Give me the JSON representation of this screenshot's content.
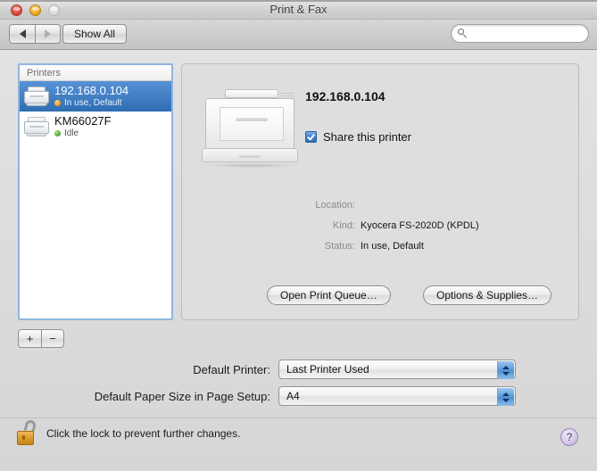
{
  "window": {
    "title": "Print & Fax",
    "traffic_lights": {
      "close": "close-button",
      "minimize": "minimize-button",
      "zoom": "zoom-button-disabled"
    }
  },
  "toolbar": {
    "back_label": "◀",
    "forward_label": "▶",
    "show_all_label": "Show All",
    "search": {
      "value": "",
      "placeholder": "",
      "icon": "search-icon"
    }
  },
  "printer_list": {
    "header": "Printers",
    "items": [
      {
        "name": "192.168.0.104",
        "status": "In use, Default",
        "status_color": "#f2a42a",
        "selected": true
      },
      {
        "name": "KM66027F",
        "status": "Idle",
        "status_color": "#4fae34",
        "selected": false
      }
    ],
    "add_label": "+",
    "remove_label": "−"
  },
  "detail": {
    "title": "192.168.0.104",
    "share_checkbox": {
      "label": "Share this printer",
      "checked": true
    },
    "info": [
      {
        "label": "Location:",
        "value": ""
      },
      {
        "label": "Kind:",
        "value": "Kyocera FS-2020D (KPDL)"
      },
      {
        "label": "Status:",
        "value": "In use, Default"
      }
    ],
    "buttons": {
      "open_queue": "Open Print Queue…",
      "options_supplies": "Options & Supplies…"
    }
  },
  "defaults": {
    "printer_label": "Default Printer:",
    "printer_value": "Last Printer Used",
    "paper_label": "Default Paper Size in Page Setup:",
    "paper_value": "A4"
  },
  "footer": {
    "lock_text": "Click the lock to prevent further changes.",
    "lock_state": "unlocked",
    "help_label": "?"
  },
  "colors": {
    "selection_blue": "#2f6db4",
    "stepper_blue": "#5a9ade",
    "lock_gold": "#dd9c2f",
    "help_purple": "#d8cbe9"
  }
}
